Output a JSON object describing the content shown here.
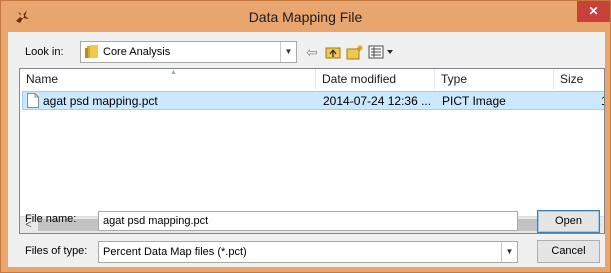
{
  "window": {
    "title": "Data Mapping File",
    "close_label": "✕"
  },
  "toolbar": {
    "look_in_label": "Look in:",
    "look_in_value": "Core Analysis",
    "back_icon": "back-arrow-icon",
    "up_icon": "up-folder-icon",
    "new_folder_icon": "new-folder-icon",
    "views_icon": "view-menu-icon"
  },
  "list": {
    "columns": [
      "Name",
      "Date modified",
      "Type",
      "Size"
    ],
    "rows": [
      {
        "name": "agat psd mapping.pct",
        "date_modified": "2014-07-24 12:36 ...",
        "type": "PICT Image",
        "size": "1"
      }
    ],
    "selected_row": 0
  },
  "scrollbar": {
    "left_arrow": "<",
    "right_arrow": ">"
  },
  "file_name": {
    "label": "File name:",
    "value": "agat psd mapping.pct"
  },
  "file_type": {
    "label": "Files of type:",
    "value": "Percent Data Map files (*.pct)"
  },
  "buttons": {
    "open": "Open",
    "cancel": "Cancel"
  },
  "colors": {
    "frame": "#e8a56e",
    "close": "#c8413a",
    "selection": "#cce8ff",
    "selection_border": "#99d1ff"
  }
}
